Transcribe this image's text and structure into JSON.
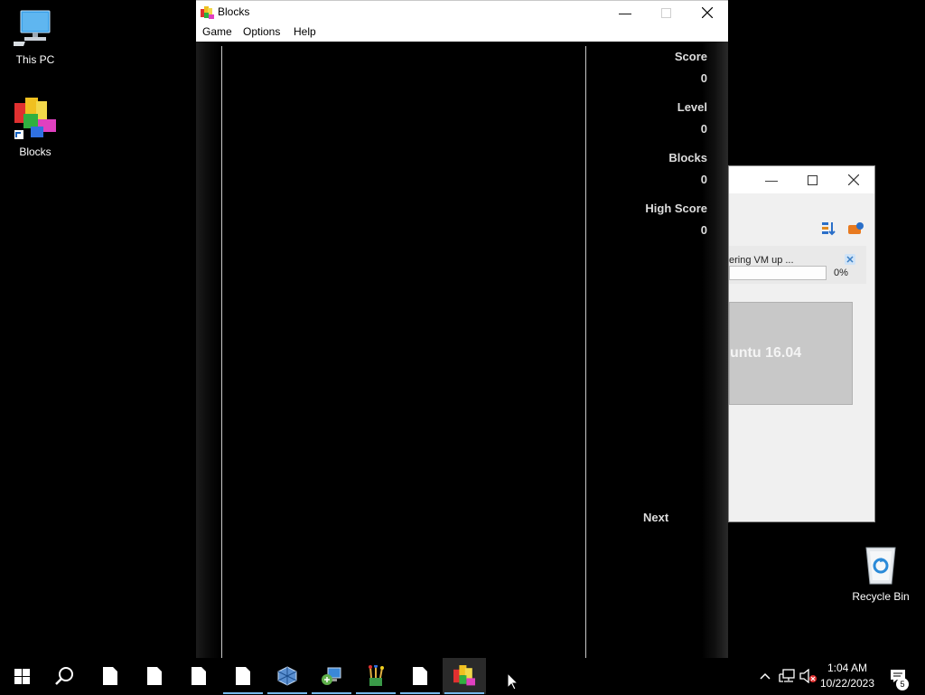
{
  "desktop": {
    "icons": [
      {
        "label": "This PC",
        "icon": "computer-icon"
      },
      {
        "label": "Blocks",
        "icon": "blocks-app-icon"
      },
      {
        "label": "Recycle Bin",
        "icon": "recycle-bin-icon"
      }
    ]
  },
  "background_window": {
    "notice_text": "ering VM up ...",
    "progress_percent": 0,
    "progress_label": "0%",
    "preview_text": "untu 16.04"
  },
  "blocks_window": {
    "title": "Blocks",
    "menu": [
      "Game",
      "Options",
      "Help"
    ],
    "stats": [
      {
        "label": "Score",
        "value": "0"
      },
      {
        "label": "Level",
        "value": "0"
      },
      {
        "label": "Blocks",
        "value": "0"
      },
      {
        "label": "High Score",
        "value": "0"
      }
    ],
    "next_label": "Next"
  },
  "taskbar": {
    "items": [
      {
        "icon": "windows-start-icon",
        "running": false
      },
      {
        "icon": "search-icon",
        "running": false
      },
      {
        "icon": "document-icon",
        "running": false
      },
      {
        "icon": "document-icon",
        "running": false
      },
      {
        "icon": "document-icon",
        "running": false
      },
      {
        "icon": "document-icon",
        "running": true
      },
      {
        "icon": "virtualbox-icon",
        "running": true
      },
      {
        "icon": "network-setup-icon",
        "running": true
      },
      {
        "icon": "paint-brushes-icon",
        "running": true
      },
      {
        "icon": "document-icon",
        "running": true
      },
      {
        "icon": "blocks-app-icon",
        "running": true,
        "active": true
      }
    ],
    "tray_icons": [
      "chevron-up-icon",
      "network-icon",
      "volume-muted-icon"
    ],
    "clock": {
      "time": "1:04 AM",
      "date": "10/22/2023"
    },
    "notification_count": "5"
  },
  "colors": {
    "accent": "#76b9ed",
    "background": "#000000",
    "stat_text": "#dddddd"
  }
}
